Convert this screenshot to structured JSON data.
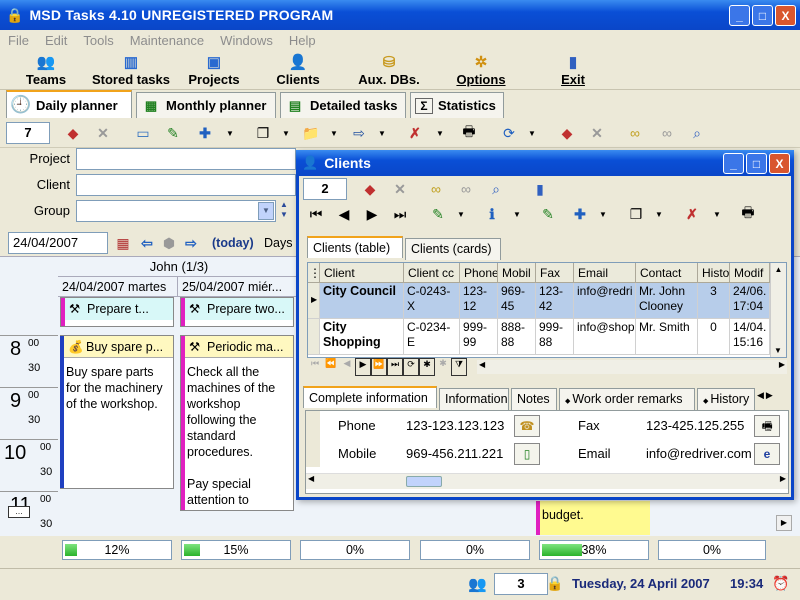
{
  "window": {
    "title": "MSD Tasks 4.10 UNREGISTERED PROGRAM",
    "minimize": "_",
    "maximize": "□",
    "close": "X"
  },
  "menu": [
    "File",
    "Edit",
    "Tools",
    "Maintenance",
    "Windows",
    "Help"
  ],
  "toolbar": {
    "teams": "Teams",
    "stored_tasks": "Stored tasks",
    "projects": "Projects",
    "clients": "Clients",
    "aux_dbs": "Aux. DBs.",
    "options": "Options",
    "exit": "Exit"
  },
  "tabs": {
    "daily": "Daily planner",
    "monthly": "Monthly planner",
    "detailed": "Detailed tasks",
    "statistics": "Statistics"
  },
  "toolbar2": {
    "count": "7"
  },
  "filters": {
    "project": "Project",
    "client": "Client",
    "group": "Group"
  },
  "datebar": {
    "date": "24/04/2007",
    "today": "(today)",
    "days": "Days"
  },
  "planner": {
    "person": "John (1/3)",
    "days": [
      "24/04/2007 martes",
      "25/04/2007 miér..."
    ],
    "hours": [
      "8",
      "9",
      "10",
      "11"
    ],
    "min00": "00",
    "min30": "30",
    "tasks": [
      {
        "title": "Prepare t...",
        "body": ""
      },
      {
        "title": "Prepare two...",
        "body": ""
      },
      {
        "title": "Buy spare p...",
        "body": "Buy spare parts for the machinery of the workshop."
      },
      {
        "title": "Periodic ma...",
        "body": "Check all the machines of the workshop following the standard procedures.\n\nPay special attention to"
      },
      {
        "title": "",
        "body": "budget."
      }
    ],
    "progress": [
      "12%",
      "15%",
      "0%",
      "0%",
      "38%",
      "0%"
    ],
    "progress_values": [
      0.12,
      0.15,
      0,
      0,
      0.38,
      0
    ]
  },
  "status": {
    "count": "3",
    "date": "Tuesday, 24 April 2007",
    "time": "19:34"
  },
  "clients_window": {
    "title": "Clients",
    "count": "2",
    "tabs": {
      "table": "Clients (table)",
      "cards": "Clients (cards)"
    },
    "columns": [
      "Client",
      "Client cc",
      "Phone",
      "Mobil",
      "Fax",
      "Email",
      "Contact",
      "Histo",
      "Modif"
    ],
    "rows": [
      [
        "City Council",
        "C-0243-X",
        "123-12",
        "969-45",
        "123-42",
        "info@redri",
        "Mr. John\nClooney",
        "3",
        "24/06.\n17:04"
      ],
      [
        "City\nShopping",
        "C-0234-E",
        "999-99",
        "888-88",
        "999-88",
        "info@shop",
        "Mr. Smith",
        "0",
        "14/04.\n15:16"
      ]
    ],
    "detail_tabs": [
      "Complete information",
      "Information",
      "Notes",
      "Work order remarks",
      "History"
    ],
    "detail": {
      "phone_label": "Phone",
      "phone": "123-123.123.123",
      "mobile_label": "Mobile",
      "mobile": "969-456.211.221",
      "fax_label": "Fax",
      "fax": "123-425.125.255",
      "email_label": "Email",
      "email": "info@redriver.com"
    }
  }
}
